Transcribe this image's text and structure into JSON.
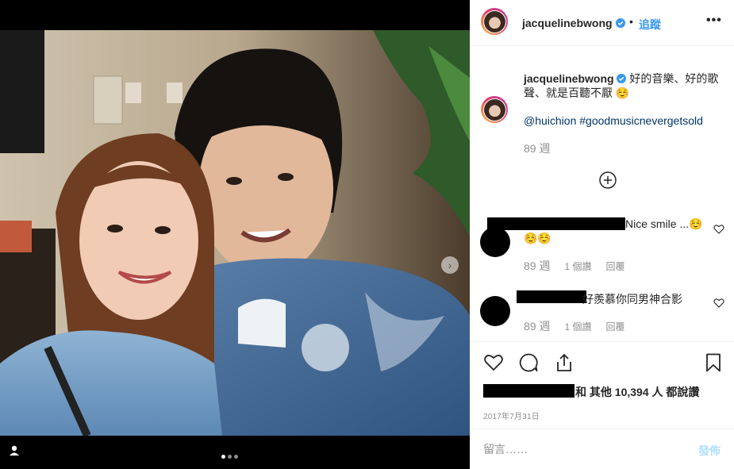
{
  "header": {
    "username": "jacquelinebwong",
    "bullet": "•",
    "follow_label": "追蹤",
    "more_label": "•••"
  },
  "caption": {
    "username": "jacquelinebwong",
    "text": "好的音樂、好的歌聲、就是百聽不厭 ☺️",
    "mention": "@huichion",
    "hashtag": "#goodmusicnevergetsold",
    "time": "89 週"
  },
  "comments": [
    {
      "text": "Nice smile ...☺️",
      "text_line2": "☺️☺️",
      "time": "89 週",
      "likes": "1 個讚",
      "reply": "回覆"
    },
    {
      "text": "好羨慕你同男神合影",
      "time": "89 週",
      "likes": "1 個讚",
      "reply": "回覆"
    }
  ],
  "likes_line": {
    "suffix": "和 其他 10,394 人 都說讚"
  },
  "date": "2017年7月31日",
  "comment_input": {
    "placeholder": "留言……",
    "post_label": "發佈"
  },
  "carousel": {
    "total_slides": 3,
    "active_slide": 1
  },
  "colors": {
    "link_blue": "#3897f0",
    "hashtag_blue": "#003569",
    "muted_gray": "#8e8e8e",
    "post_disabled": "#b2dffc",
    "verified_blue": "#3897f0"
  }
}
